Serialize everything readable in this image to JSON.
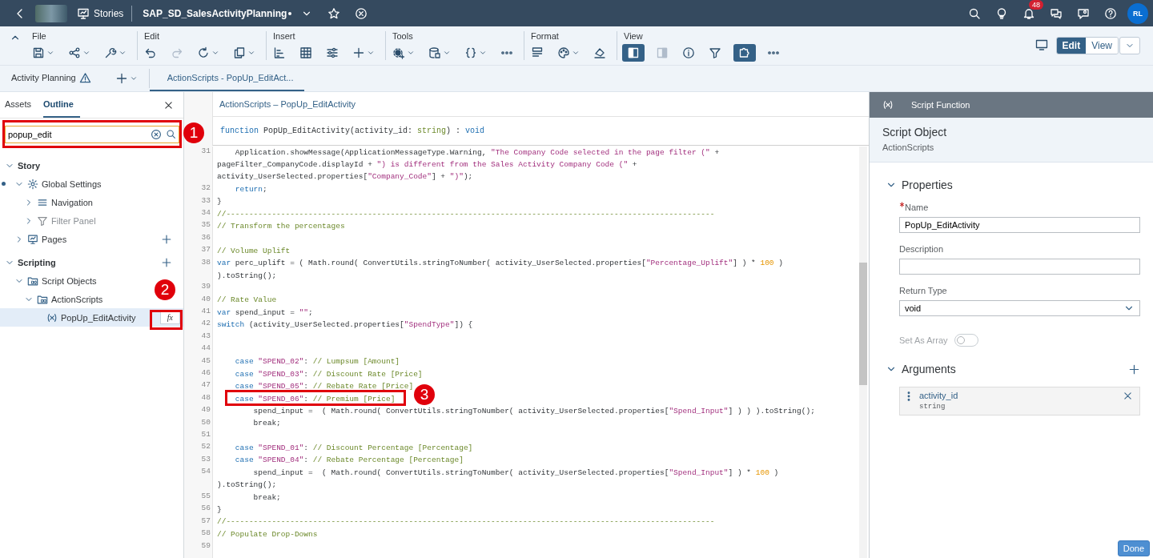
{
  "shell": {
    "breadcrumb": "Stories",
    "title": "SAP_SD_SalesActivityPlanning",
    "modified": true,
    "notifications": "48",
    "avatar": "RL"
  },
  "toolbar": {
    "groups": [
      {
        "label": "File",
        "buttons": [
          {
            "kind": "save",
            "menu": true,
            "on": false,
            "disabled": false
          },
          {
            "kind": "share",
            "menu": true,
            "on": false,
            "disabled": false
          },
          {
            "kind": "wrench",
            "menu": true,
            "on": false,
            "disabled": false
          }
        ]
      },
      {
        "label": "Edit",
        "buttons": [
          {
            "kind": "undo",
            "menu": false,
            "on": false,
            "disabled": false
          },
          {
            "kind": "redo",
            "menu": false,
            "on": false,
            "disabled": true
          },
          {
            "kind": "refresh",
            "menu": true,
            "on": false,
            "disabled": false
          },
          {
            "kind": "copy",
            "menu": true,
            "on": false,
            "disabled": false
          }
        ]
      },
      {
        "label": "Insert",
        "buttons": [
          {
            "kind": "chart",
            "menu": false,
            "on": false,
            "disabled": false
          },
          {
            "kind": "table",
            "menu": false,
            "on": false,
            "disabled": false
          },
          {
            "kind": "sliders",
            "menu": false,
            "on": false,
            "disabled": false
          },
          {
            "kind": "plus",
            "menu": true,
            "on": false,
            "disabled": false
          }
        ]
      },
      {
        "label": "Tools",
        "buttons": [
          {
            "kind": "script",
            "menu": true,
            "on": false,
            "disabled": false
          },
          {
            "kind": "data",
            "menu": true,
            "on": false,
            "disabled": false
          },
          {
            "kind": "braces",
            "menu": true,
            "on": false,
            "disabled": false
          },
          {
            "kind": "more",
            "menu": false,
            "on": false,
            "disabled": false
          }
        ]
      },
      {
        "label": "Format",
        "buttons": [
          {
            "kind": "layout",
            "menu": false,
            "on": false,
            "disabled": false
          },
          {
            "kind": "palette",
            "menu": true,
            "on": false,
            "disabled": false
          },
          {
            "kind": "css",
            "menu": false,
            "on": false,
            "disabled": false
          }
        ]
      },
      {
        "label": "View",
        "buttons": [
          {
            "kind": "leftpanel",
            "menu": false,
            "on": true,
            "disabled": false
          },
          {
            "kind": "rightpanel",
            "menu": false,
            "on": false,
            "disabled": true
          },
          {
            "kind": "info",
            "menu": false,
            "on": false,
            "disabled": false
          },
          {
            "kind": "filter",
            "menu": false,
            "on": false,
            "disabled": false
          },
          {
            "kind": "puzzle",
            "menu": false,
            "on": true,
            "disabled": false
          },
          {
            "kind": "more",
            "menu": false,
            "on": false,
            "disabled": false
          }
        ]
      }
    ],
    "modes": [
      {
        "label": "Edit",
        "selected": true
      },
      {
        "label": "View",
        "selected": false
      }
    ]
  },
  "page_tabs": [
    {
      "label": "Activity Planning",
      "kind": "page",
      "warning": true,
      "selected": false
    },
    {
      "label": "ActionScripts - PopUp_EditAct...",
      "kind": "script",
      "warning": false,
      "selected": true
    }
  ],
  "outline": {
    "tabs": [
      {
        "label": "Assets",
        "selected": false
      },
      {
        "label": "Outline",
        "selected": true
      }
    ],
    "search": {
      "value": "popup_edit"
    },
    "tree": [
      {
        "label": "Story",
        "kind": "section",
        "expanded": true,
        "selected": false,
        "disabled": false,
        "children": [
          {
            "label": "Global Settings",
            "kind": "gear",
            "expanded": true,
            "selected": false,
            "disabled": false,
            "modified": true,
            "children": [
              {
                "label": "Navigation",
                "kind": "menu",
                "expanded": false,
                "selected": false,
                "disabled": false
              },
              {
                "label": "Filter Panel",
                "kind": "filter",
                "expanded": false,
                "selected": false,
                "disabled": true
              }
            ]
          },
          {
            "label": "Pages",
            "kind": "board",
            "expanded": false,
            "selected": false,
            "disabled": false,
            "add_button": true
          }
        ]
      },
      {
        "label": "Scripting",
        "kind": "section",
        "expanded": true,
        "selected": false,
        "disabled": false,
        "add_button": true,
        "children": [
          {
            "label": "Script Objects",
            "kind": "folderx",
            "expanded": true,
            "selected": false,
            "disabled": false,
            "children": [
              {
                "label": "ActionScripts",
                "kind": "folderx",
                "expanded": true,
                "selected": false,
                "disabled": false,
                "children": [
                  {
                    "label": "PopUp_EditActivity",
                    "kind": "fnx",
                    "selected": true,
                    "disabled": false,
                    "action": "fx"
                  }
                ]
              }
            ]
          }
        ]
      }
    ]
  },
  "editor": {
    "breadcrumb": "ActionScripts – PopUp_EditActivity",
    "signature": [
      {
        "kind": "keyword",
        "text": "function"
      },
      {
        "kind": "plain",
        "text": " PopUp_EditActivity(activity_id: "
      },
      {
        "kind": "type",
        "text": "string"
      },
      {
        "kind": "plain",
        "text": ") : "
      },
      {
        "kind": "keyword",
        "text": "void"
      }
    ],
    "lines": [
      {
        "number": "31",
        "tokens": [
          {
            "kind": "plain",
            "text": "    Application.showMessage(ApplicationMessageType.Warning, "
          },
          {
            "kind": "string",
            "text": "\"The Company Code selected in the page filter (\""
          },
          {
            "kind": "plain",
            "text": " +"
          }
        ]
      },
      {
        "tokens": [
          {
            "kind": "plain",
            "text": "pageFilter_CompanyCode.displayId + "
          },
          {
            "kind": "string",
            "text": "\") is different from the Sales Activity Company Code (\""
          },
          {
            "kind": "plain",
            "text": " +"
          }
        ]
      },
      {
        "tokens": [
          {
            "kind": "plain",
            "text": "activity_UserSelected.properties["
          },
          {
            "kind": "string",
            "text": "\"Company_Code\""
          },
          {
            "kind": "plain",
            "text": "] + "
          },
          {
            "kind": "string",
            "text": "\")\""
          },
          {
            "kind": "plain",
            "text": ");"
          }
        ]
      },
      {
        "number": "32",
        "tokens": [
          {
            "kind": "keyword",
            "text": "    return"
          },
          {
            "kind": "plain",
            "text": ";"
          }
        ]
      },
      {
        "number": "33",
        "tokens": [
          {
            "kind": "plain",
            "text": "}"
          }
        ]
      },
      {
        "number": "34",
        "tokens": [
          {
            "kind": "comment",
            "text": "//-----------------------------------------------------------------------------------------------------------"
          }
        ]
      },
      {
        "number": "35",
        "tokens": [
          {
            "kind": "comment",
            "text": "// Transform the percentages"
          }
        ]
      },
      {
        "number": "36"
      },
      {
        "number": "37",
        "tokens": [
          {
            "kind": "comment",
            "text": "// Volume Uplift"
          }
        ]
      },
      {
        "number": "38",
        "tokens": [
          {
            "kind": "keyword",
            "text": "var"
          },
          {
            "kind": "plain",
            "text": " perc_uplift = ( Math.round( ConvertUtils.stringToNumber( activity_UserSelected.properties["
          },
          {
            "kind": "string",
            "text": "\"Percentage_Uplift\""
          },
          {
            "kind": "plain",
            "text": "] ) * "
          },
          {
            "kind": "number",
            "text": "100"
          },
          {
            "kind": "plain",
            "text": " )"
          }
        ]
      },
      {
        "tokens": [
          {
            "kind": "plain",
            "text": ").toString();"
          }
        ]
      },
      {
        "number": "39"
      },
      {
        "number": "40",
        "tokens": [
          {
            "kind": "comment",
            "text": "// Rate Value"
          }
        ]
      },
      {
        "number": "41",
        "tokens": [
          {
            "kind": "keyword",
            "text": "var"
          },
          {
            "kind": "plain",
            "text": " spend_input = "
          },
          {
            "kind": "string",
            "text": "\"\""
          },
          {
            "kind": "plain",
            "text": ";"
          }
        ]
      },
      {
        "number": "42",
        "tokens": [
          {
            "kind": "keyword",
            "text": "switch"
          },
          {
            "kind": "plain",
            "text": " (activity_UserSelected.properties["
          },
          {
            "kind": "string",
            "text": "\"SpendType\""
          },
          {
            "kind": "plain",
            "text": "]) {"
          }
        ]
      },
      {
        "number": "43"
      },
      {
        "number": "44"
      },
      {
        "number": "45",
        "tokens": [
          {
            "kind": "keyword",
            "text": "    case "
          },
          {
            "kind": "string",
            "text": "\"SPEND_02\""
          },
          {
            "kind": "plain",
            "text": ": "
          },
          {
            "kind": "comment",
            "text": "// Lumpsum [Amount]"
          }
        ]
      },
      {
        "number": "46",
        "tokens": [
          {
            "kind": "keyword",
            "text": "    case "
          },
          {
            "kind": "string",
            "text": "\"SPEND_03\""
          },
          {
            "kind": "plain",
            "text": ": "
          },
          {
            "kind": "comment",
            "text": "// Discount Rate [Price]"
          }
        ]
      },
      {
        "number": "47",
        "tokens": [
          {
            "kind": "keyword",
            "text": "    case "
          },
          {
            "kind": "string",
            "text": "\"SPEND_05\""
          },
          {
            "kind": "plain",
            "text": ": "
          },
          {
            "kind": "comment",
            "text": "// Rebate Rate [Price]"
          }
        ]
      },
      {
        "number": "48",
        "tokens": [
          {
            "kind": "keyword",
            "text": "    case "
          },
          {
            "kind": "string",
            "text": "\"SPEND_06\""
          },
          {
            "kind": "plain",
            "text": ": "
          },
          {
            "kind": "comment",
            "text": "// Premium [Price]"
          }
        ]
      },
      {
        "number": "49",
        "tokens": [
          {
            "kind": "plain",
            "text": "        spend_input =  ( Math.round( ConvertUtils.stringToNumber( activity_UserSelected.properties["
          },
          {
            "kind": "string",
            "text": "\"Spend_Input\""
          },
          {
            "kind": "plain",
            "text": "] ) ) ).toString();"
          }
        ]
      },
      {
        "number": "50",
        "tokens": [
          {
            "kind": "plain",
            "text": "        break;"
          }
        ]
      },
      {
        "number": "51"
      },
      {
        "number": "52",
        "tokens": [
          {
            "kind": "keyword",
            "text": "    case "
          },
          {
            "kind": "string",
            "text": "\"SPEND_01\""
          },
          {
            "kind": "plain",
            "text": ": "
          },
          {
            "kind": "comment",
            "text": "// Discount Percentage [Percentage]"
          }
        ]
      },
      {
        "number": "53",
        "tokens": [
          {
            "kind": "keyword",
            "text": "    case "
          },
          {
            "kind": "string",
            "text": "\"SPEND_04\""
          },
          {
            "kind": "plain",
            "text": ": "
          },
          {
            "kind": "comment",
            "text": "// Rebate Percentage [Percentage]"
          }
        ]
      },
      {
        "number": "54",
        "tokens": [
          {
            "kind": "plain",
            "text": "        spend_input =  ( Math.round( ConvertUtils.stringToNumber( activity_UserSelected.properties["
          },
          {
            "kind": "string",
            "text": "\"Spend_Input\""
          },
          {
            "kind": "plain",
            "text": "] ) * "
          },
          {
            "kind": "number",
            "text": "100"
          },
          {
            "kind": "plain",
            "text": " )"
          }
        ]
      },
      {
        "tokens": [
          {
            "kind": "plain",
            "text": ").toString();"
          }
        ]
      },
      {
        "number": "55",
        "tokens": [
          {
            "kind": "plain",
            "text": "        break;"
          }
        ]
      },
      {
        "number": "56",
        "tokens": [
          {
            "kind": "plain",
            "text": "}"
          }
        ]
      },
      {
        "number": "57",
        "tokens": [
          {
            "kind": "comment",
            "text": "//-----------------------------------------------------------------------------------------------------------"
          }
        ]
      },
      {
        "number": "58",
        "tokens": [
          {
            "kind": "comment",
            "text": "// Populate Drop-Downs"
          }
        ]
      },
      {
        "number": "59"
      }
    ]
  },
  "properties": {
    "header": "Script Function",
    "object_title": "Script Object",
    "object_subtitle": "ActionScripts",
    "sections": [
      {
        "title": "Properties",
        "expanded": true,
        "add_button": false,
        "fields": [
          {
            "kind": "text",
            "label": "Name",
            "required": true,
            "value": "PopUp_EditActivity"
          },
          {
            "kind": "text",
            "label": "Description",
            "required": false
          },
          {
            "kind": "select",
            "label": "Return Type",
            "required": false,
            "value": "void"
          },
          {
            "kind": "toggle",
            "label": "Set As Array",
            "on": false,
            "disabled": true
          }
        ]
      },
      {
        "title": "Arguments",
        "expanded": true,
        "add_button": true,
        "arguments": [
          {
            "name": "activity_id",
            "type": "string"
          }
        ]
      }
    ],
    "done": "Done"
  },
  "annotations": [
    {
      "number": "1"
    },
    {
      "number": "2"
    },
    {
      "number": "3"
    }
  ]
}
